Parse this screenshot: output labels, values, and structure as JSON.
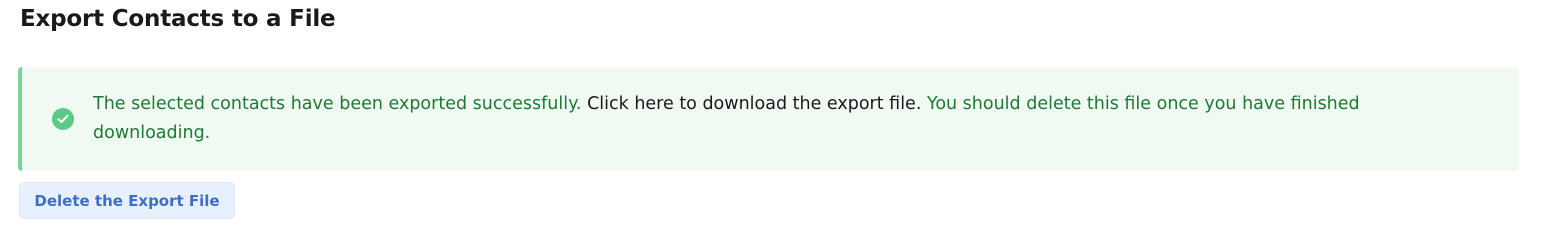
{
  "page": {
    "title": "Export Contacts to a File"
  },
  "alert": {
    "icon": "check-circle-icon",
    "text_before_link": "The selected contacts have been exported successfully. ",
    "link_text": "Click here to download the export file.",
    "text_after_link": " You should delete this file once you have finished downloading."
  },
  "actions": {
    "delete_label": "Delete the Export File"
  },
  "colors": {
    "success_text": "#1d7a33",
    "success_background": "#f0faf3",
    "success_border": "#7ed39a",
    "success_icon": "#5cc987",
    "button_background": "#e8f0fd",
    "button_text": "#3e6fc6"
  }
}
